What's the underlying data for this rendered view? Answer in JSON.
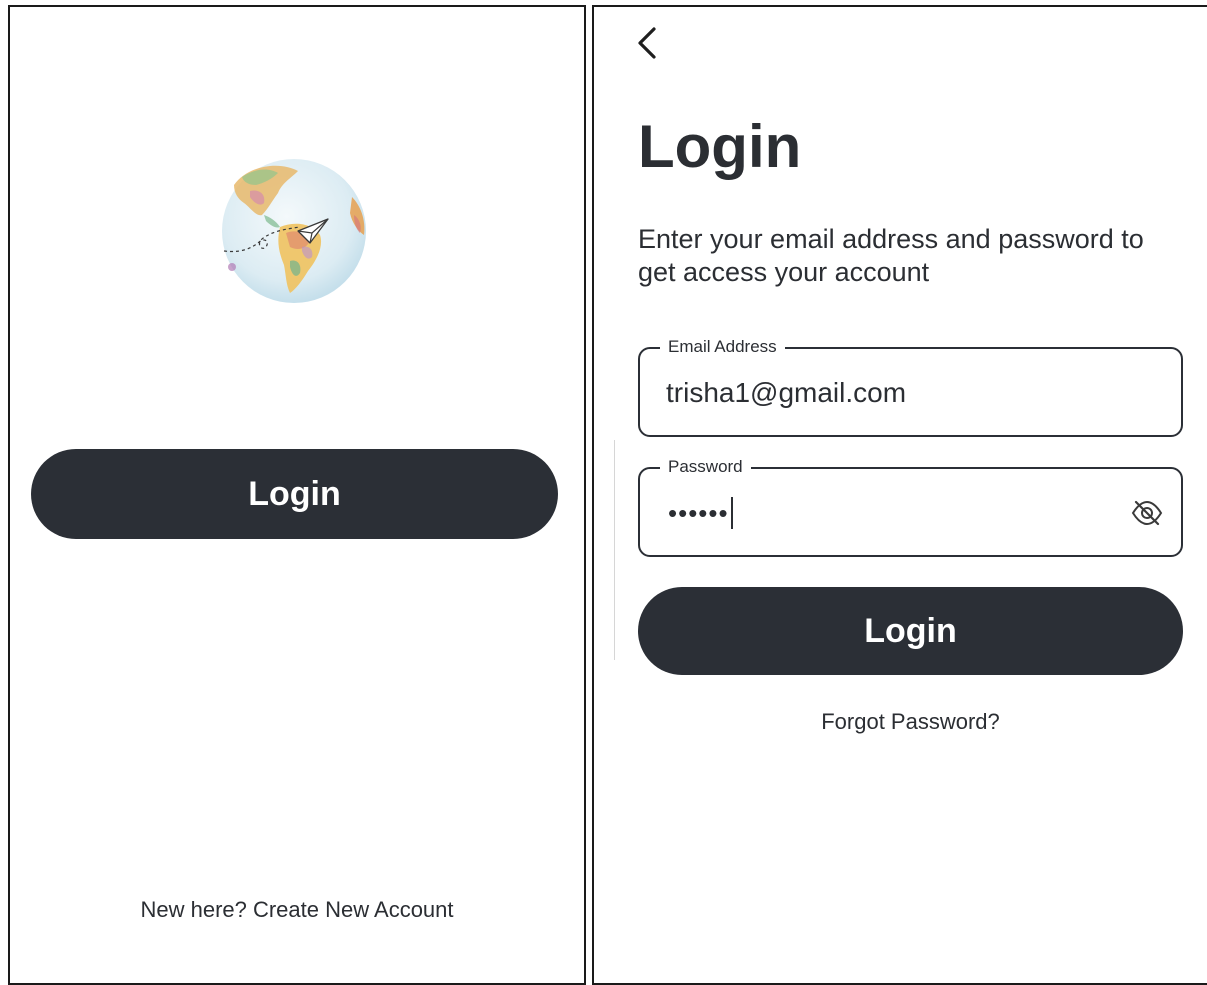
{
  "welcome_screen": {
    "logo_icon": "globe-paper-plane-icon",
    "login_button_label": "Login",
    "create_account_text": "New here? Create New Account"
  },
  "login_screen": {
    "back_icon": "chevron-left-icon",
    "title": "Login",
    "subtitle": "Enter your email address and password to get access your account",
    "email": {
      "label": "Email Address",
      "value": "trisha1@gmail.com"
    },
    "password": {
      "label": "Password",
      "masked_value": "••••••",
      "visibility_icon": "eye-off-icon"
    },
    "login_button_label": "Login",
    "forgot_password_text": "Forgot Password?"
  },
  "colors": {
    "primary_button": "#2b2f36",
    "text": "#2b2e33",
    "background": "#ffffff"
  }
}
